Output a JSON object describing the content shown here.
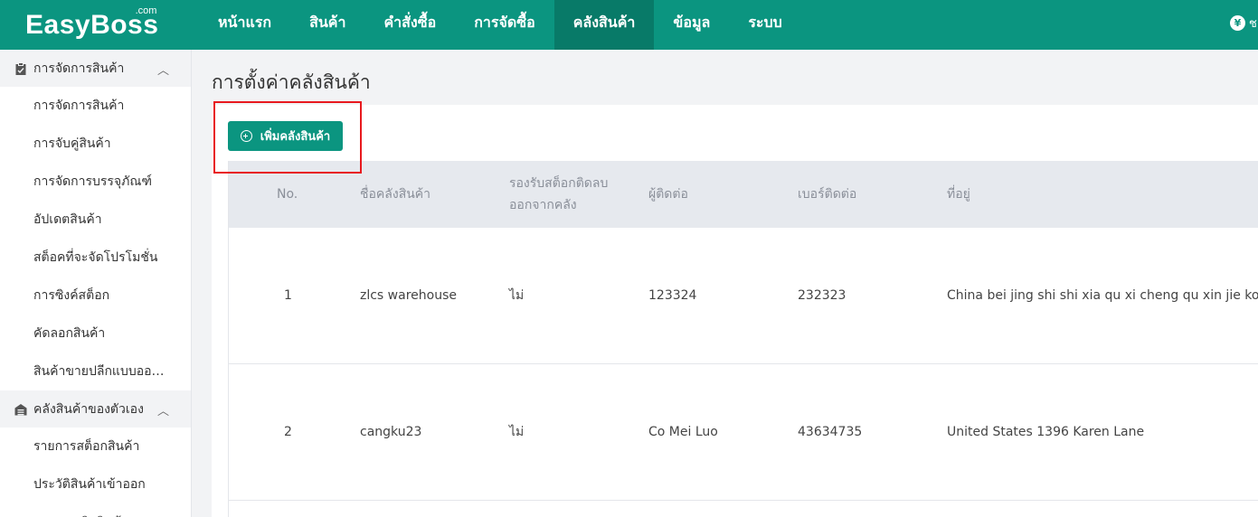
{
  "brand": {
    "name": "EasyBoss",
    "suffix": ".com"
  },
  "nav": [
    {
      "label": "หน้าแรก"
    },
    {
      "label": "สินค้า"
    },
    {
      "label": "คำสั่งซื้อ"
    },
    {
      "label": "การจัดซื้อ"
    },
    {
      "label": "คลังสินค้า"
    },
    {
      "label": "ข้อมูล"
    },
    {
      "label": "ระบบ"
    }
  ],
  "top_right": {
    "coin_glyph": "¥",
    "label": "ช"
  },
  "sidebar": {
    "groups": [
      {
        "title": "การจัดการสินค้า",
        "icon": "clipboard-icon",
        "items": [
          "การจัดการสินค้า",
          "การจับคู่สินค้า",
          "การจัดการบรรจุภัณฑ์",
          "อัปเดตสินค้า",
          "สต็อคที่จะจัดโปรโมชั่น",
          "การซิงค์สต็อก",
          "คัดลอกสินค้า",
          "สินค้าขายปลีกแบบออนไลน์"
        ]
      },
      {
        "title": "คลังสินค้าของตัวเอง",
        "icon": "warehouse-icon",
        "items": [
          "รายการสต็อกสินค้า",
          "ประวัติสินค้าเข้าออก",
          "รายการเบิกสินค้า"
        ]
      }
    ]
  },
  "page": {
    "title": "การตั้งค่าคลังสินค้า",
    "add_button": "เพิ่มคลังสินค้า"
  },
  "table": {
    "columns": [
      "No.",
      "ชื่อคลังสินค้า",
      "รองรับสต็อกติดลบ ออกจากคลัง",
      "ผู้ติดต่อ",
      "เบอร์ติดต่อ",
      "ที่อยู่"
    ],
    "rows": [
      [
        "1",
        "zlcs warehouse",
        "ไม่",
        "123324",
        "232323",
        "China bei jing shi shi xia qu xi cheng qu xin jie kou"
      ],
      [
        "2",
        "cangku23",
        "ไม่",
        "Co Mei Luo",
        "43634735",
        "United States 1396 Karen Lane"
      ]
    ]
  },
  "colors": {
    "primary": "#0b9580",
    "primary_dark": "#087a68",
    "highlight": "#e8191e"
  }
}
